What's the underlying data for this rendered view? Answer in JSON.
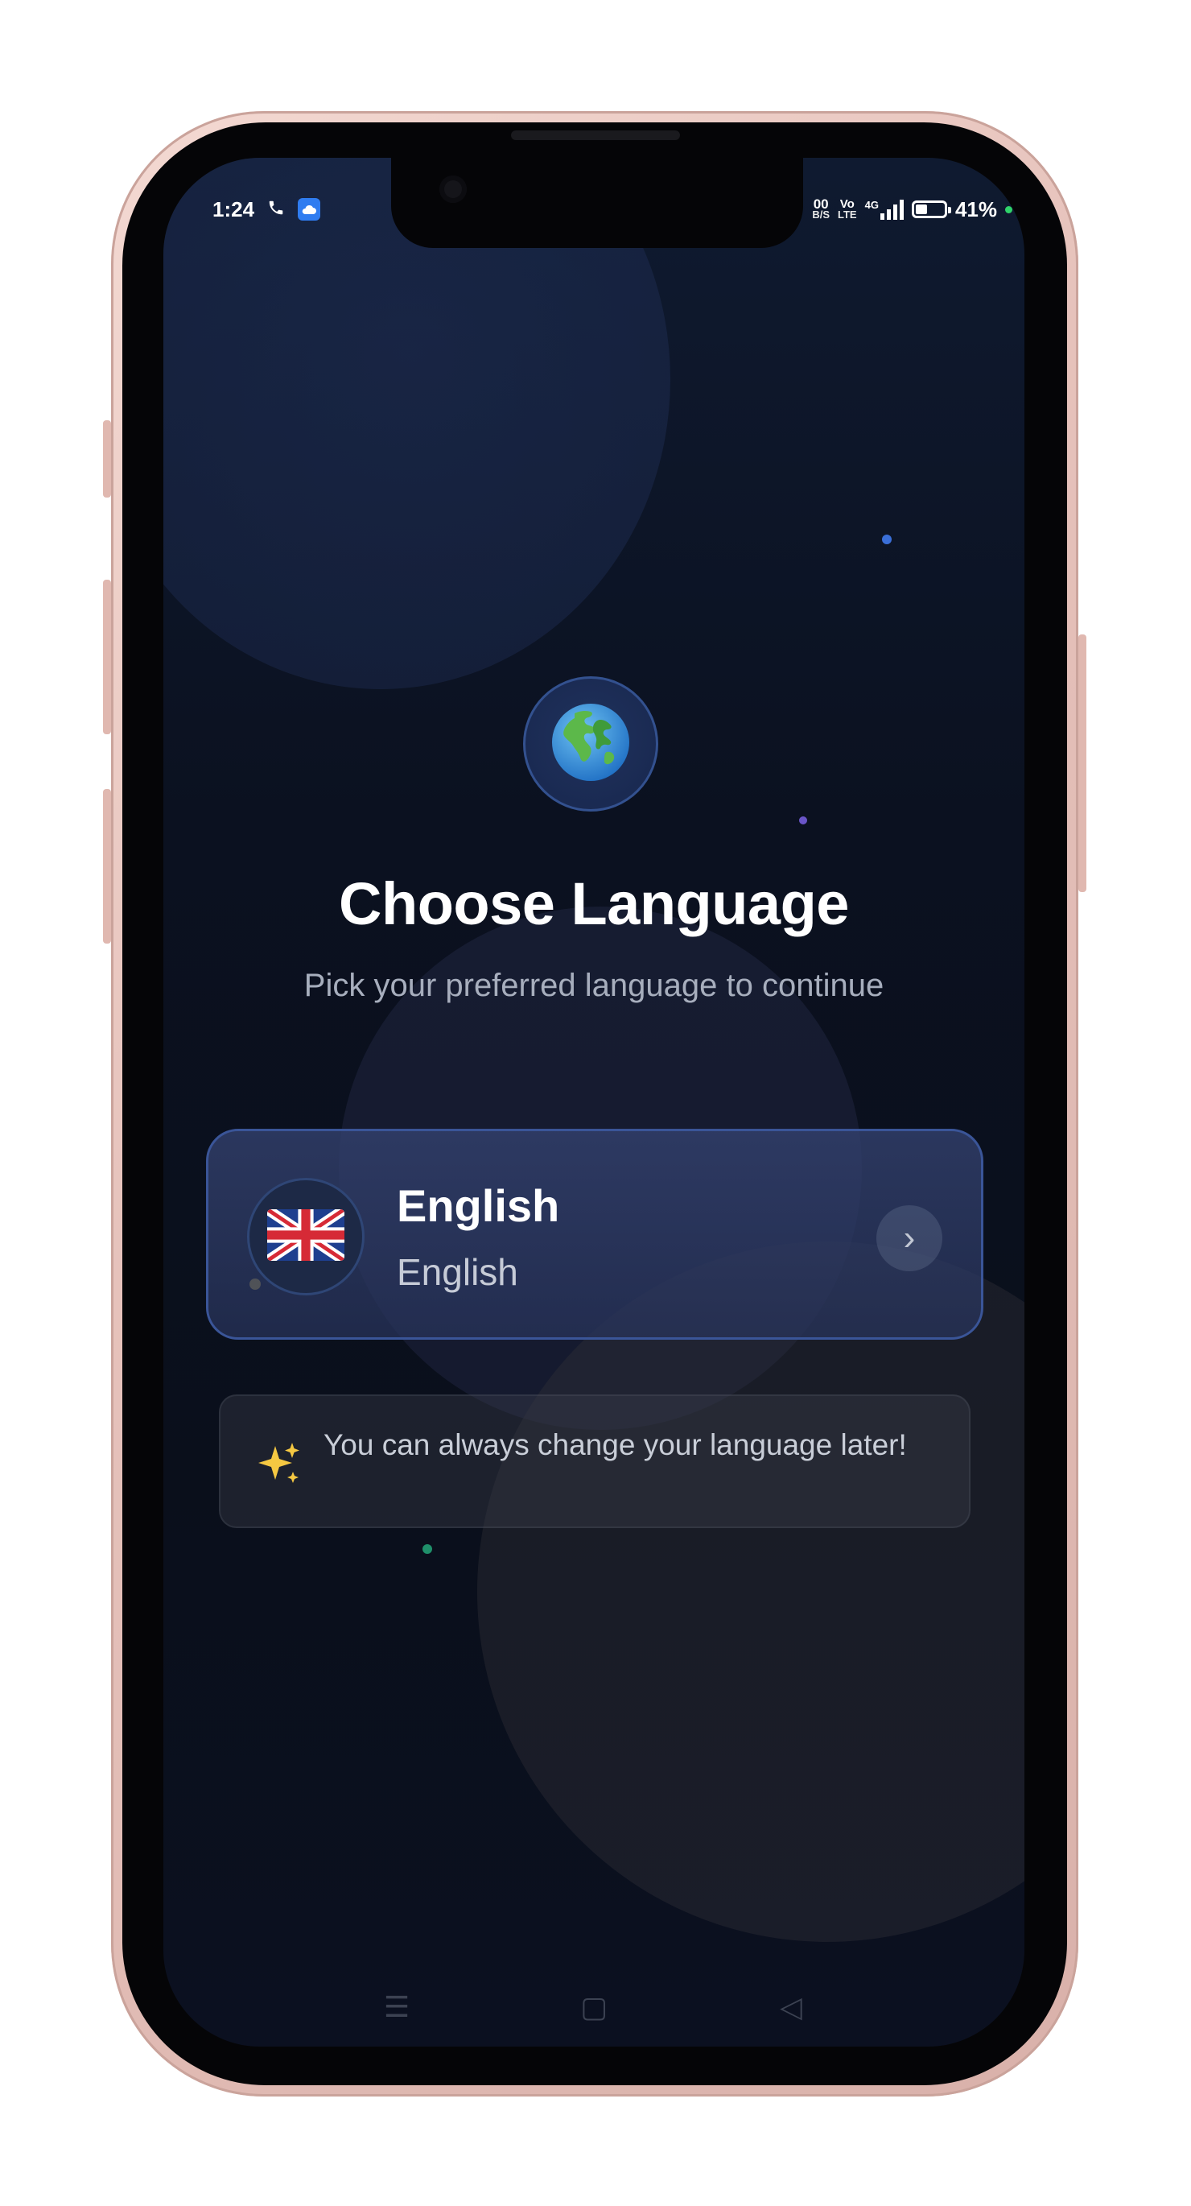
{
  "status_bar": {
    "time": "1:24",
    "call_icon": "phone-icon",
    "app_icon": "cloud-icon",
    "net_speed_top": "00",
    "net_speed_unit": "B/S",
    "volte_top": "Vo",
    "volte_bottom": "LTE",
    "network_type": "4G",
    "battery_percent": "41%",
    "battery_level": 0.41
  },
  "header": {
    "globe_icon": "globe-icon",
    "title": "Choose Language",
    "subtitle": "Pick your preferred language to continue"
  },
  "languages": [
    {
      "flag_icon": "uk-flag-icon",
      "name": "English",
      "native_name": "English",
      "chevron": "›"
    }
  ],
  "hint": {
    "icon": "sparkles-icon",
    "text": "You can always change your language later!"
  },
  "nav": {
    "menu_glyph": "☰",
    "home_glyph": "▢",
    "back_glyph": "◁"
  },
  "colors": {
    "background": "#0b1120",
    "card_border": "#3a5598",
    "title": "#ffffff",
    "subtitle": "#a7aebd",
    "status_green": "#2fd36a"
  }
}
